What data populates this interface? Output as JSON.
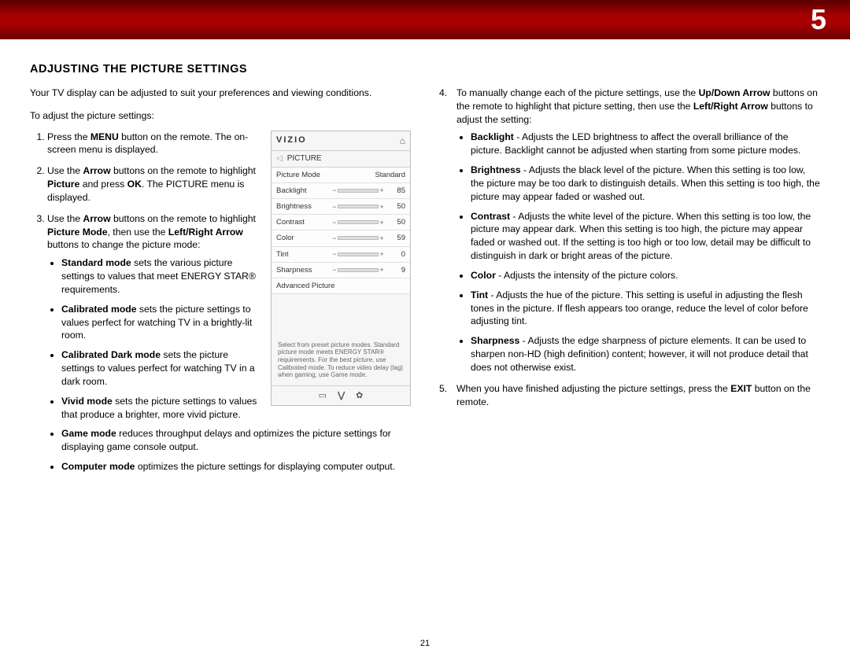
{
  "chapter": "5",
  "page_number": "21",
  "title": "ADJUSTING THE PICTURE SETTINGS",
  "intro": "Your TV display can be adjusted to suit your preferences and viewing conditions.",
  "lead": "To adjust the picture settings:",
  "steps_left": {
    "s1a": "Press the ",
    "s1b": "MENU",
    "s1c": " button on the remote. The on-screen menu is displayed.",
    "s2a": "Use the ",
    "s2b": "Arrow",
    "s2c": " buttons on the remote to highlight ",
    "s2d": "Picture",
    "s2e": " and press ",
    "s2f": "OK",
    "s2g": ". The PICTURE menu is displayed.",
    "s3a": "Use the ",
    "s3b": "Arrow",
    "s3c": " buttons on the remote to highlight ",
    "s3d": "Picture Mode",
    "s3e": ", then use the ",
    "s3f": "Left/Right Arrow",
    "s3g": " buttons to change the picture mode:"
  },
  "modes": {
    "std_b": "Standard mode",
    "std_t": " sets the various picture settings to values that meet ENERGY STAR® requirements.",
    "cal_b": "Calibrated mode",
    "cal_t": " sets the picture settings to values perfect for watching TV in a brightly-lit room.",
    "cad_b": "Calibrated Dark mode",
    "cad_t": " sets the picture settings to values perfect for watching TV in a dark room.",
    "viv_b": "Vivid mode",
    "viv_t": " sets the picture settings to values that produce a brighter, more vivid picture.",
    "gam_b": "Game mode",
    "gam_t": " reduces throughput delays and optimizes the picture settings for displaying game console output.",
    "com_b": "Computer mode",
    "com_t": " optimizes the picture settings for displaying computer output."
  },
  "osd": {
    "brand": "VIZIO",
    "menu": "PICTURE",
    "rows": {
      "mode_l": "Picture Mode",
      "mode_v": "Standard",
      "backlight_l": "Backlight",
      "backlight_v": "85",
      "brightness_l": "Brightness",
      "brightness_v": "50",
      "contrast_l": "Contrast",
      "contrast_v": "50",
      "color_l": "Color",
      "color_v": "59",
      "tint_l": "Tint",
      "tint_v": "0",
      "sharp_l": "Sharpness",
      "sharp_v": "9",
      "adv_l": "Advanced Picture"
    },
    "help": "Select from preset picture modes. Standard picture mode meets ENERGY STAR® requirements. For the best picture, use Calibrated mode. To reduce video delay (lag) when gaming, use Game mode."
  },
  "step4": {
    "a": "To manually change each of the picture settings, use the ",
    "b": "Up/Down Arrow",
    "c": " buttons on the remote to highlight that picture setting, then use the ",
    "d": "Left/Right Arrow",
    "e": " buttons to adjust the setting:"
  },
  "settings": {
    "bl_b": "Backlight",
    "bl_t": " - Adjusts the LED brightness to affect the overall brilliance of the picture. Backlight cannot be adjusted when starting from some picture modes.",
    "br_b": "Brightness",
    "br_t": " - Adjusts the black level of the picture. When this setting is too low, the picture may be too dark to distinguish details. When this setting is too high, the picture may appear faded or washed out.",
    "co_b": "Contrast",
    "co_t": " - Adjusts the white level of the picture. When this setting is too low, the picture may appear dark. When this setting is too high, the picture may appear faded or washed out. If the setting is too high or too low, detail may be difficult to distinguish in dark or bright areas of the picture.",
    "cl_b": "Color",
    "cl_t": " - Adjusts the intensity of the picture colors.",
    "ti_b": "Tint",
    "ti_t": " - Adjusts the hue of the picture. This setting is useful in adjusting the flesh tones in the picture. If flesh appears too orange, reduce the level of color before adjusting tint.",
    "sh_b": "Sharpness",
    "sh_t": " - Adjusts the edge sharpness of picture elements. It can be used to sharpen non-HD (high definition) content; however, it will not produce detail that does not otherwise exist."
  },
  "step5": {
    "a": "When you have finished adjusting the picture settings, press the ",
    "b": "EXIT",
    "c": " button on the remote."
  }
}
